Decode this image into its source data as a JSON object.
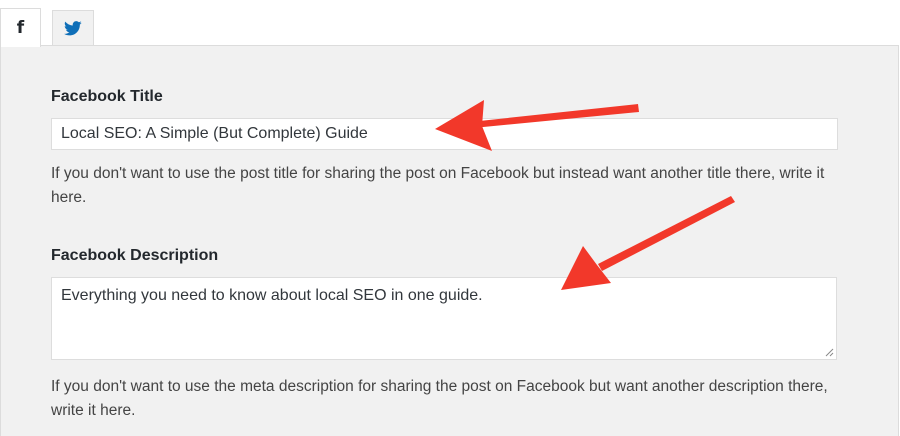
{
  "tabs": [
    {
      "icon": "facebook-icon",
      "glyph": "f",
      "active": true
    },
    {
      "icon": "twitter-icon",
      "active": false
    }
  ],
  "facebook_title": {
    "label": "Facebook Title",
    "value": "Local SEO: A Simple (But Complete) Guide",
    "help": "If you don't want to use the post title for sharing the post on Facebook but instead want another title there, write it here."
  },
  "facebook_description": {
    "label": "Facebook Description",
    "value": "Everything you need to know about local SEO in one guide.",
    "help": "If you don't want to use the meta description for sharing the post on Facebook but want another description there, write it here."
  },
  "colors": {
    "arrow": "#f2382a",
    "twitter": "#0f6fb8",
    "panel_bg": "#f1f1f1",
    "border": "#dcdcdc"
  }
}
